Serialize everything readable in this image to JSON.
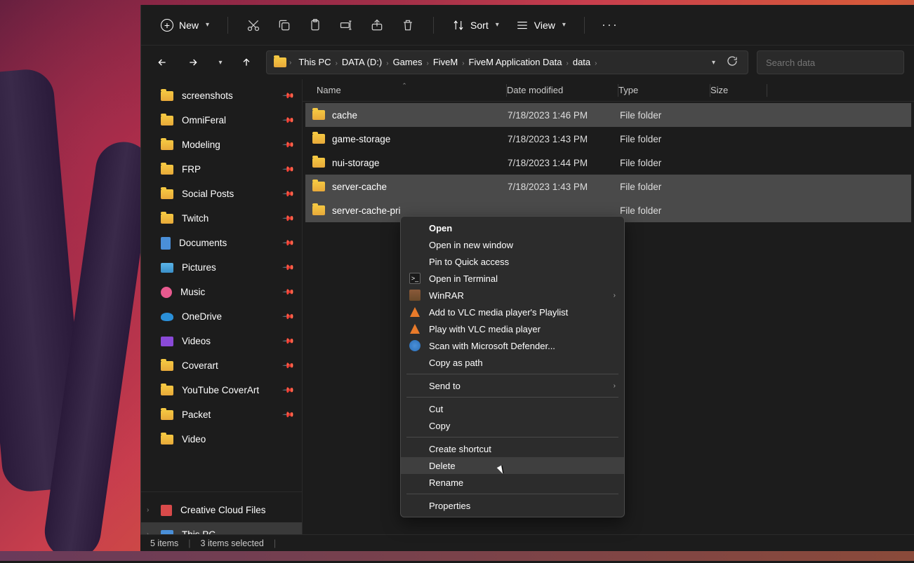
{
  "toolbar": {
    "new_label": "New",
    "sort_label": "Sort",
    "view_label": "View"
  },
  "breadcrumb": [
    "This PC",
    "DATA (D:)",
    "Games",
    "FiveM",
    "FiveM Application Data",
    "data"
  ],
  "search_placeholder": "Search data",
  "sidebar": {
    "items": [
      {
        "label": "screenshots",
        "icon": "folder",
        "pinned": true
      },
      {
        "label": "OmniFeral",
        "icon": "folder",
        "pinned": true
      },
      {
        "label": "Modeling",
        "icon": "folder",
        "pinned": true
      },
      {
        "label": "FRP",
        "icon": "folder",
        "pinned": true
      },
      {
        "label": "Social Posts",
        "icon": "folder",
        "pinned": true
      },
      {
        "label": "Twitch",
        "icon": "folder",
        "pinned": true
      },
      {
        "label": "Documents",
        "icon": "doc",
        "pinned": true
      },
      {
        "label": "Pictures",
        "icon": "pic",
        "pinned": true
      },
      {
        "label": "Music",
        "icon": "music",
        "pinned": true
      },
      {
        "label": "OneDrive",
        "icon": "onedrive",
        "pinned": true
      },
      {
        "label": "Videos",
        "icon": "video",
        "pinned": true
      },
      {
        "label": "Coverart",
        "icon": "folder",
        "pinned": true
      },
      {
        "label": "YouTube CoverArt",
        "icon": "folder",
        "pinned": true
      },
      {
        "label": "Packet",
        "icon": "folder",
        "pinned": true
      },
      {
        "label": "Video",
        "icon": "folder",
        "pinned": false
      }
    ],
    "bottom": [
      {
        "label": "Creative Cloud Files",
        "icon": "cc",
        "expand": true
      },
      {
        "label": "This PC",
        "icon": "pc",
        "expand": true,
        "selected": true
      }
    ]
  },
  "columns": {
    "name": "Name",
    "date": "Date modified",
    "type": "Type",
    "size": "Size"
  },
  "files": [
    {
      "name": "cache",
      "date": "7/18/2023 1:46 PM",
      "type": "File folder",
      "selected": true
    },
    {
      "name": "game-storage",
      "date": "7/18/2023 1:43 PM",
      "type": "File folder",
      "selected": false
    },
    {
      "name": "nui-storage",
      "date": "7/18/2023 1:44 PM",
      "type": "File folder",
      "selected": false
    },
    {
      "name": "server-cache",
      "date": "7/18/2023 1:43 PM",
      "type": "File folder",
      "selected": true
    },
    {
      "name": "server-cache-pri",
      "date": "",
      "type": "File folder",
      "selected": true
    }
  ],
  "context_menu": [
    {
      "label": "Open",
      "bold": true
    },
    {
      "label": "Open in new window"
    },
    {
      "label": "Pin to Quick access"
    },
    {
      "label": "Open in Terminal",
      "icon": "term"
    },
    {
      "label": "WinRAR",
      "icon": "winrar",
      "submenu": true
    },
    {
      "label": "Add to VLC media player's Playlist",
      "icon": "vlc"
    },
    {
      "label": "Play with VLC media player",
      "icon": "vlc"
    },
    {
      "label": "Scan with Microsoft Defender...",
      "icon": "def"
    },
    {
      "label": "Copy as path"
    },
    {
      "sep": true
    },
    {
      "label": "Send to",
      "submenu": true
    },
    {
      "sep": true
    },
    {
      "label": "Cut"
    },
    {
      "label": "Copy"
    },
    {
      "sep": true
    },
    {
      "label": "Create shortcut"
    },
    {
      "label": "Delete",
      "hover": true
    },
    {
      "label": "Rename"
    },
    {
      "sep": true
    },
    {
      "label": "Properties"
    }
  ],
  "status": {
    "items": "5 items",
    "selected": "3 items selected"
  }
}
